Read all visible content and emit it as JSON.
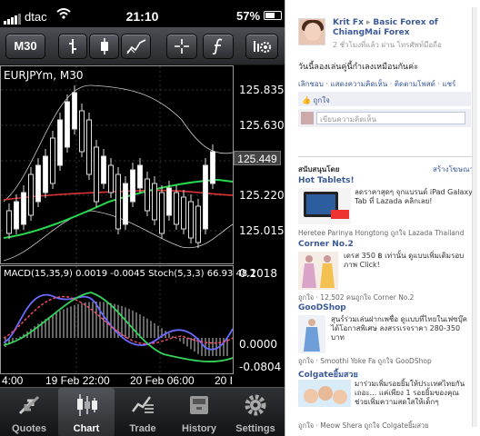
{
  "statusbar": {
    "carrier": "dtac",
    "time": "21:10",
    "battery": "57%"
  },
  "toolbar": {
    "timeframe_label": "M30",
    "buttons": [
      "bar-chart-icon",
      "candlestick-icon",
      "line-chart-icon",
      "crosshair-icon",
      "function-icon",
      "settings-icon"
    ]
  },
  "chart": {
    "symbol_label": "EURJPYm, M30",
    "price_ticks": [
      "125.835",
      "125.630",
      "125.220",
      "125.015"
    ],
    "current_price": "125.449",
    "macd_label": "MACD(15,35,9) 0.0019 -0.0045 Stoch(5,3,3) 66.93 48.1",
    "indicator_ticks": [
      "0.2018",
      "0.0000",
      "-0.0804"
    ],
    "time_ticks": [
      "4:00",
      "19 Feb 22:00",
      "20 Feb 06:00",
      "20 I"
    ],
    "colors": {
      "upper_band": "#ffffff",
      "mid_ma": "#e23232",
      "fast_ma": "#29d94f",
      "macd_line": "#6b6bff",
      "signal_line": "#ff4d6d",
      "stoch_fast": "#36d35a"
    }
  },
  "tabbar": {
    "tabs": [
      {
        "label": "Quotes",
        "icon": "quotes-arrows-icon",
        "active": false
      },
      {
        "label": "Chart",
        "icon": "candlestick-icon",
        "active": true
      },
      {
        "label": "Trade",
        "icon": "trade-chart-icon",
        "active": false
      },
      {
        "label": "History",
        "icon": "history-drawer-icon",
        "active": false
      },
      {
        "label": "Settings",
        "icon": "gear-icon",
        "active": false
      }
    ]
  },
  "facebook": {
    "post": {
      "author": "Krit Fx",
      "page": "Basic Forex of ChiangMai Forex",
      "meta": "2 ชั่วโมงที่แล้ว ผ่าน โทรศัพท์มือถือ",
      "text": "วันนี้ลองเล่นคู่นี้กำเลงเหมือนกันค่ะ",
      "actions": "เลิกชอบ · แสดงความคิดเห็น · ติดตามโพสต์ · แชร์",
      "likes": "ถูกใจ",
      "comment_placeholder": "เขียนความคิดเห็น"
    },
    "sponsored": {
      "title": "สนับสนุนโดย",
      "create": "สร้างโฆษณา"
    },
    "ads": [
      {
        "title": "Hot Tablets!",
        "body": "ลดราคาสุดๆ จุกแบรนด์ iPad Galaxy Tab ที่ Lazada คลิกเลย!",
        "like": "Heretee Parinya Hongtong ถูกใจ Lazada Thailand",
        "like_link": ""
      },
      {
        "title": "Corner No.2",
        "body": "เดรส 350 ฿ เท่านั้น ดูแบบเพิ่มเติมรอบภาพ Click!",
        "like": "ถูกใจ · 12,502 คนถูกใจ Corner No.2",
        "like_link": ""
      },
      {
        "title": "GooDShop",
        "body": "สุนร์ร่วมเล่นฝากเพชื่อ ดูแบบที่ไทยในเฟซบุ๊ค ได้โอกาสพิเศษ ลงสรรเรจราคา 280-350 บาท",
        "like": "ถูกใจ · Smoothi Yoke Fa ถูกใจ GooDShop",
        "like_link": ""
      },
      {
        "title": "Colgateยิ้มสวย",
        "body": "มาร่วมเพิ่มรอยยิ้มให้ประเทศไทยกันเถอะ... แค่เพียง 1 รอยยิ้มของคุณ ช่วยเพิ่มความสดใสให้เด็กๆ",
        "like": "ถูกใจ · Meow Shera ถูกใจ Colgateยิ้มสวย",
        "like_link": ""
      }
    ]
  }
}
